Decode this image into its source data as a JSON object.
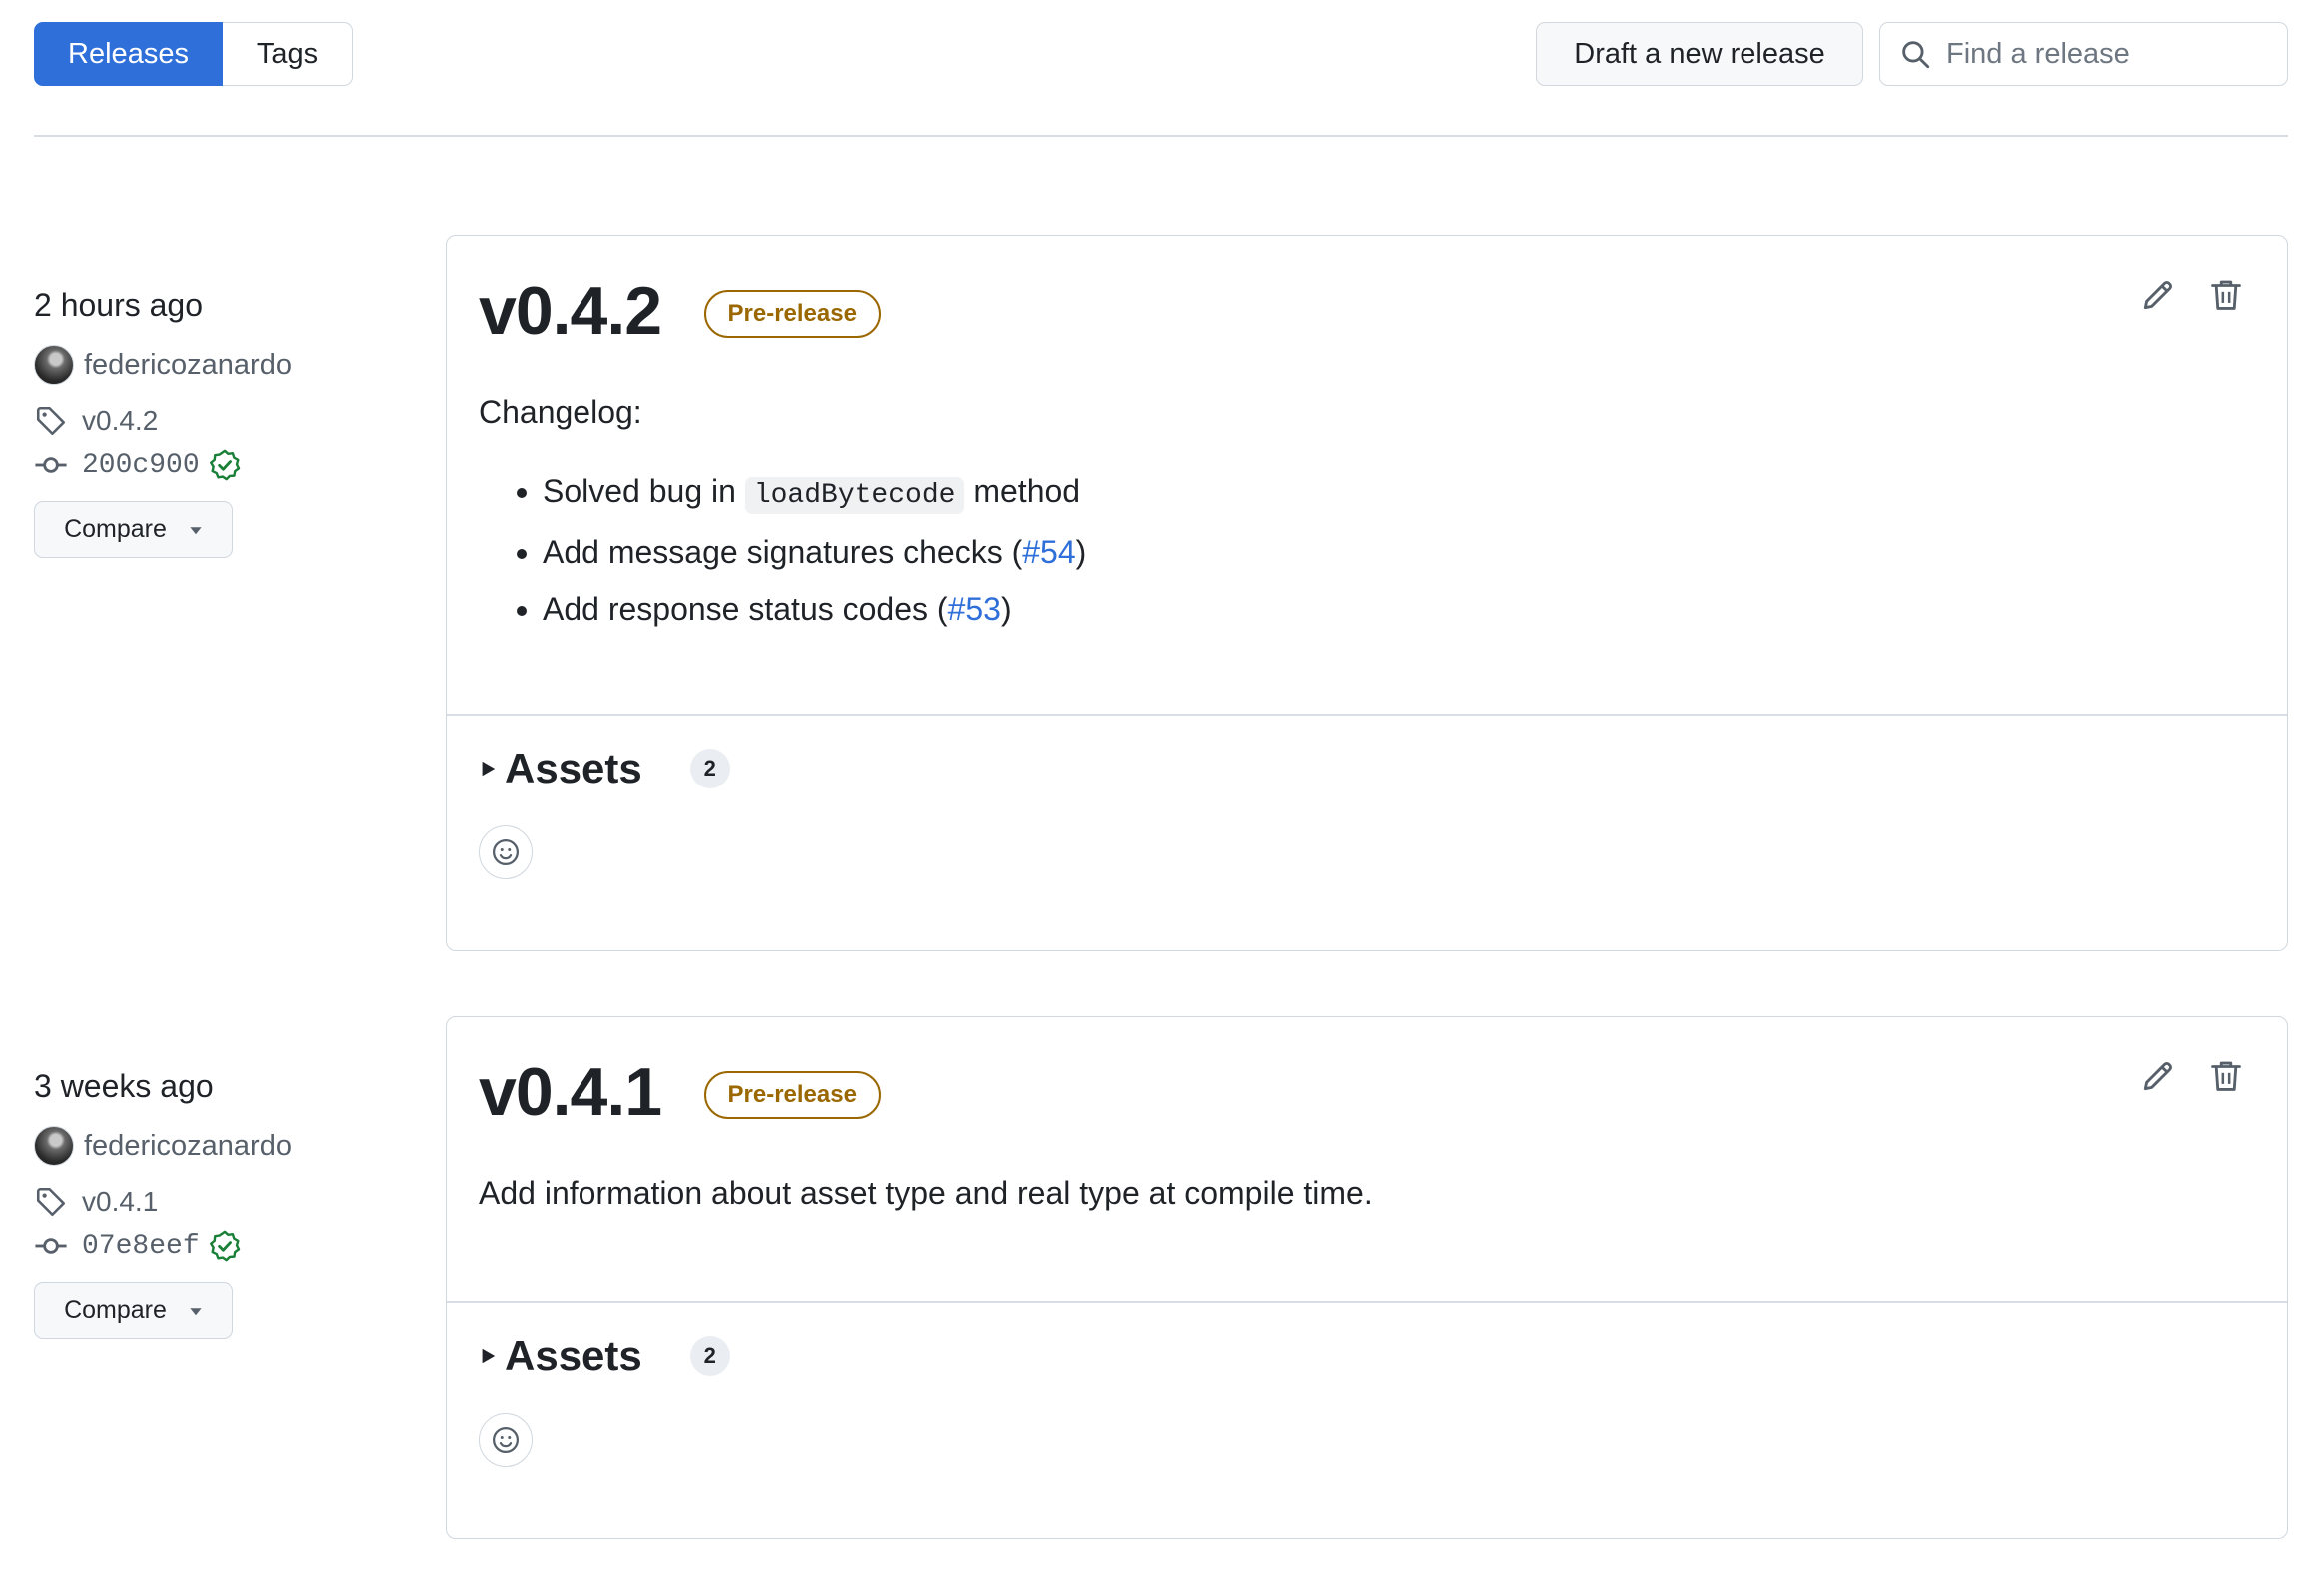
{
  "tabs": {
    "releases": "Releases",
    "tags": "Tags"
  },
  "toolbar": {
    "draft_label": "Draft a new release",
    "search_placeholder": "Find a release"
  },
  "colors": {
    "accent": "#2f6fd9",
    "prerelease": "#9a6700",
    "verified": "#1a7f37"
  },
  "releases": [
    {
      "when": "2 hours ago",
      "author": "federicozanardo",
      "tag": "v0.4.2",
      "commit": "200c900",
      "compare_label": "Compare",
      "version": "v0.4.2",
      "badge": "Pre-release",
      "changelog_heading": "Changelog:",
      "notes": [
        {
          "before": "Solved bug in ",
          "code": "loadBytecode",
          "after": " method"
        },
        {
          "before": "Add message signatures checks (",
          "link": "#54",
          "after": ")"
        },
        {
          "before": "Add response status codes (",
          "link": "#53",
          "after": ")"
        }
      ],
      "assets_label": "Assets",
      "assets_count": "2"
    },
    {
      "when": "3 weeks ago",
      "author": "federicozanardo",
      "tag": "v0.4.1",
      "commit": "07e8eef",
      "compare_label": "Compare",
      "version": "v0.4.1",
      "badge": "Pre-release",
      "description": "Add information about asset type and real type at compile time.",
      "assets_label": "Assets",
      "assets_count": "2"
    }
  ]
}
